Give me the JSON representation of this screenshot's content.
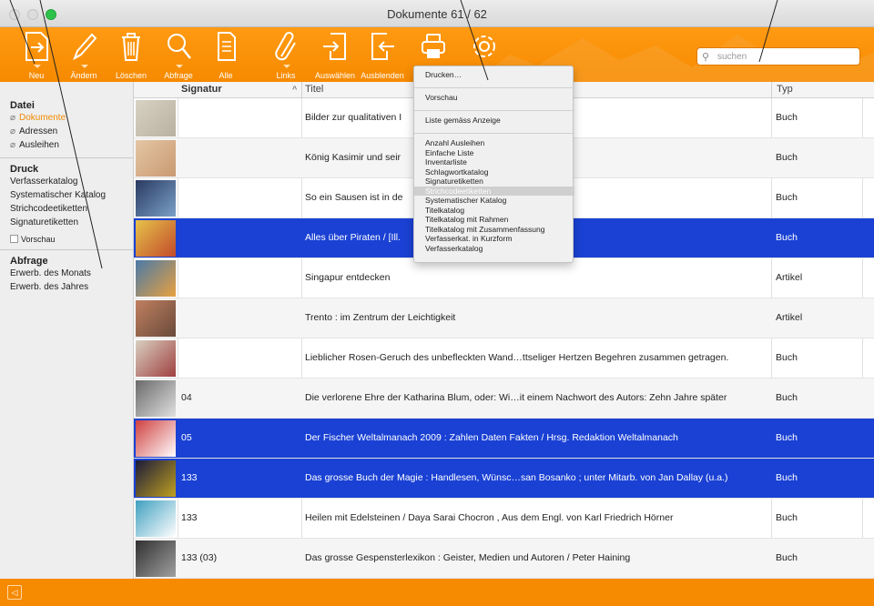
{
  "window": {
    "title": "Dokumente 61 / 62"
  },
  "toolbar": {
    "buttons": [
      {
        "label": "Neu",
        "icon": "new-document-icon"
      },
      {
        "label": "Ändern",
        "icon": "pencil-icon"
      },
      {
        "label": "Löschen",
        "icon": "trash-icon"
      },
      {
        "label": "Abfrage",
        "icon": "magnifier-icon"
      },
      {
        "label": "Alle",
        "icon": "documents-icon"
      },
      {
        "label": "Links",
        "icon": "paperclip-icon"
      },
      {
        "label": "Auswählen",
        "icon": "select-in-icon"
      },
      {
        "label": "Ausblenden",
        "icon": "select-out-icon"
      },
      {
        "label": "",
        "icon": "printer-icon"
      },
      {
        "label": "",
        "icon": "gear-icon"
      }
    ],
    "search_placeholder": "suchen"
  },
  "sidebar": {
    "sections": [
      {
        "title": "Datei",
        "items": [
          "Dokumente",
          "Adressen",
          "Ausleihen"
        ]
      },
      {
        "title": "Druck",
        "items": [
          "Verfasserkatalog",
          "Systematischer Katalog",
          "Strichcodeetiketten",
          "Signaturetiketten"
        ],
        "checkbox": "Vorschau"
      },
      {
        "title": "Abfrage",
        "items": [
          "Erwerb. des Monats",
          "Erwerb. des Jahres"
        ]
      }
    ]
  },
  "table": {
    "columns": {
      "signatur": "Signatur",
      "titel": "Titel",
      "typ": "Typ"
    },
    "rows": [
      {
        "signatur": "",
        "titel": "Bilder zur qualitativen I",
        "typ": "Buch",
        "selected": false
      },
      {
        "signatur": "",
        "titel": "König Kasimir und seir",
        "typ": "Buch",
        "selected": false
      },
      {
        "signatur": "",
        "titel": "So ein Sausen ist in de",
        "typ": "Buch",
        "selected": false
      },
      {
        "signatur": "",
        "titel": "Alles über Piraten / [Ill.",
        "typ": "Buch",
        "selected": true
      },
      {
        "signatur": "",
        "titel": "Singapur entdecken",
        "typ": "Artikel",
        "selected": false
      },
      {
        "signatur": "",
        "titel": "Trento : im Zentrum der Leichtigkeit",
        "typ": "Artikel",
        "selected": false
      },
      {
        "signatur": "",
        "titel": "Lieblicher Rosen-Geruch des unbefleckten Wand…ttseliger Hertzen Begehren zusammen getragen.",
        "typ": "Buch",
        "selected": false
      },
      {
        "signatur": "04",
        "titel": "Die verlorene Ehre der Katharina Blum, oder: Wi…it einem Nachwort des Autors: Zehn Jahre später",
        "typ": "Buch",
        "selected": false
      },
      {
        "signatur": "05",
        "titel": "Der Fischer Weltalmanach 2009 : Zahlen Daten Fakten / Hrsg. Redaktion Weltalmanach",
        "typ": "Buch",
        "selected": true
      },
      {
        "signatur": "133",
        "titel": "Das grosse Buch der Magie : Handlesen, Wünsc…san Bosanko ; unter Mitarb. von Jan Dallay (u.a.)",
        "typ": "Buch",
        "selected": true
      },
      {
        "signatur": "133",
        "titel": "Heilen mit Edelsteinen / Daya Sarai Chocron , Aus dem Engl. von Karl Friedrich Hörner",
        "typ": "Buch",
        "selected": false
      },
      {
        "signatur": "133 (03)",
        "titel": "Das grosse Gespensterlexikon : Geister, Medien und Autoren / Peter Haining",
        "typ": "Buch",
        "selected": false
      }
    ]
  },
  "print_menu": {
    "items": [
      {
        "label": "Drucken…",
        "group": 0
      },
      {
        "label": "Vorschau",
        "group": 1
      },
      {
        "label": "Liste gemäss Anzeige",
        "group": 2
      },
      {
        "label": "Anzahl Ausleihen",
        "group": 3
      },
      {
        "label": "Einfache Liste",
        "group": 3
      },
      {
        "label": "Inventarliste",
        "group": 3
      },
      {
        "label": "Schlagwortkatalog",
        "group": 3
      },
      {
        "label": "Signaturetiketten",
        "group": 3
      },
      {
        "label": "Strichcodeetiketten",
        "group": 3,
        "highlighted": true
      },
      {
        "label": "Systematischer Katalog",
        "group": 3
      },
      {
        "label": "Titelkatalog",
        "group": 3
      },
      {
        "label": "Titelkatalog mit Rahmen",
        "group": 3
      },
      {
        "label": "Titelkatalog mit Zusammenfassung",
        "group": 3
      },
      {
        "label": "Verfasserkat. in Kurzform",
        "group": 3
      },
      {
        "label": "Verfasserkatalog",
        "group": 3
      }
    ]
  },
  "colors": {
    "accent": "#f68a00",
    "selection": "#1a41d4",
    "active_sidebar": "#f28a00"
  }
}
